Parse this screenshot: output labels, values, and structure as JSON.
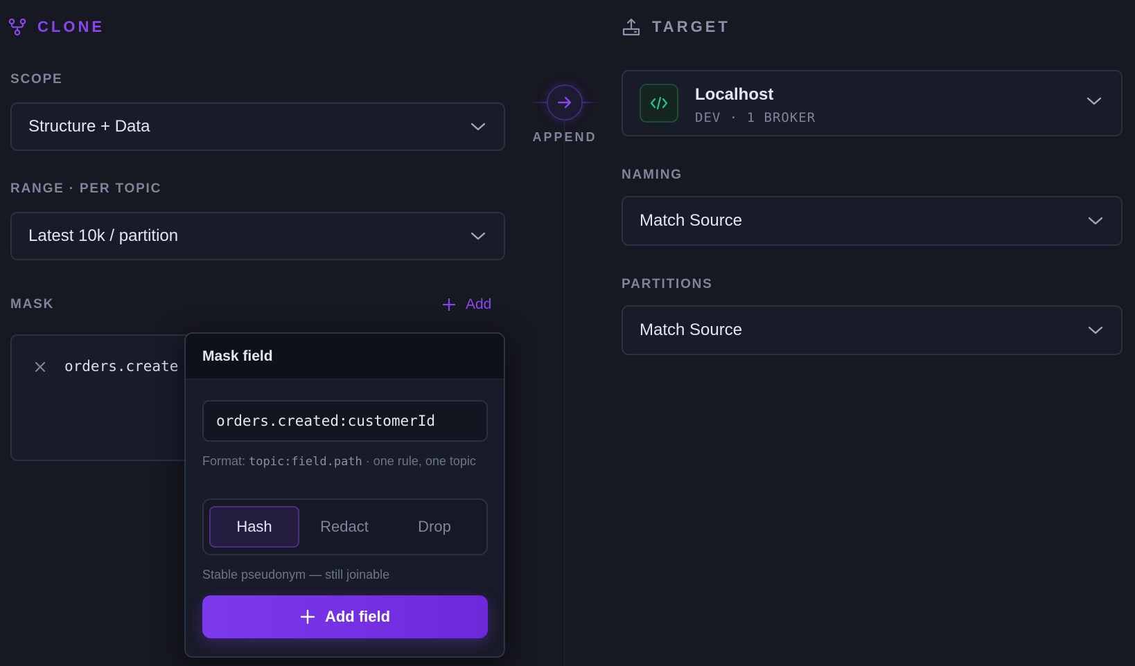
{
  "clone": {
    "title": "CLONE",
    "scope": {
      "label": "SCOPE",
      "value": "Structure + Data"
    },
    "range": {
      "label": "RANGE · PER TOPIC",
      "value": "Latest 10k / partition"
    },
    "mask": {
      "label": "MASK",
      "add_label": "Add",
      "rows": [
        {
          "path": "orders.create"
        }
      ]
    }
  },
  "popover": {
    "title": "Mask field",
    "input_value": "orders.created:customerId",
    "hint_prefix": "Format: ",
    "hint_code": "topic:field.path",
    "hint_suffix": " · one rule, one topic",
    "modes": [
      "Hash",
      "Redact",
      "Drop"
    ],
    "active_mode": "Hash",
    "description": "Stable pseudonym — still joinable",
    "submit_label": "Add field"
  },
  "connector": {
    "label": "APPEND"
  },
  "target": {
    "title": "TARGET",
    "name": "Localhost",
    "meta": "DEV · 1 BROKER",
    "naming": {
      "label": "NAMING",
      "value": "Match Source"
    },
    "partitions": {
      "label": "PARTITIONS",
      "value": "Match Source"
    }
  },
  "colors": {
    "accent": "#8b45f0",
    "background": "#161822",
    "surface": "#181b28",
    "target_icon": "#22c58b"
  },
  "icons": {
    "clone": "branch-fork-icon",
    "target": "upload-tray-icon",
    "chevron": "chevron-down-icon",
    "connector": "arrow-right-icon",
    "remove": "close-icon",
    "add": "plus-icon",
    "target_type": "code-icon"
  }
}
